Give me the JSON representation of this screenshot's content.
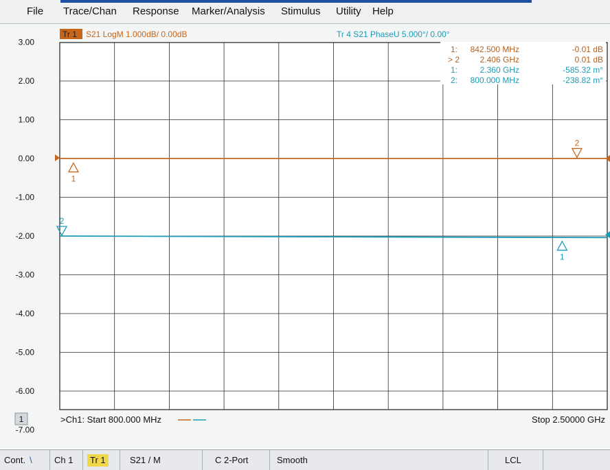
{
  "menu": {
    "items": [
      "File",
      "Trace/Chan",
      "Response",
      "Marker/Analysis",
      "Stimulus",
      "Utility",
      "Help"
    ]
  },
  "trace1": {
    "tag": "Tr 1",
    "label": "S21 LogM 1.000dB/ 0.00dB",
    "color": "#c7651a"
  },
  "trace4": {
    "label": "Tr 4  S21 PhaseU 5.000°/ 0.00°",
    "color": "#1b9bb7"
  },
  "marker_table": [
    {
      "id": "1:",
      "freq": "842.500 MHz",
      "value": "-0.01 dB",
      "trace": "tr1"
    },
    {
      "id": "> 2",
      "freq": "2.406 GHz",
      "value": "0.01 dB",
      "trace": "tr1"
    },
    {
      "id": "1:",
      "freq": "2.360 GHz",
      "value": "-585.32 m°",
      "trace": "tr4"
    },
    {
      "id": "2:",
      "freq": "800.000 MHz",
      "value": "-238.82 m°",
      "trace": "tr4"
    }
  ],
  "axis": {
    "y_ticks": [
      "3.00",
      "2.00",
      "1.00",
      "0.00",
      "-1.00",
      "-2.00",
      "-3.00",
      "-4.00",
      "-5.00",
      "-6.00",
      "-7.00"
    ],
    "start_label": ">Ch1: Start  800.000 MHz",
    "stop_label": "Stop  2.50000 GHz",
    "channel_box": "1"
  },
  "chart_data": {
    "type": "line",
    "x_unit": "MHz",
    "xlim": [
      800,
      2500
    ],
    "ylim": [
      -7,
      3
    ],
    "y_ticks": [
      3,
      2,
      1,
      0,
      -1,
      -2,
      -3,
      -4,
      -5,
      -6,
      -7
    ],
    "grid": true,
    "series": [
      {
        "name": "S21 LogM 1.000dB/ 0.00dB",
        "color": "#c7651a",
        "x": [
          800,
          2500
        ],
        "values": [
          0.0,
          0.0
        ]
      },
      {
        "name": "S21 PhaseU 5.000°/ 0.00°",
        "color": "#1b9bb7",
        "x": [
          800,
          2500
        ],
        "values": [
          -2.0,
          -2.04
        ]
      }
    ],
    "markers": [
      {
        "series": 0,
        "label": "1",
        "x": 842.5,
        "y": -0.01
      },
      {
        "series": 0,
        "label": "2",
        "x": 2406,
        "y": 0.01
      },
      {
        "series": 1,
        "label": "1",
        "x": 2360,
        "y": -2.03
      },
      {
        "series": 1,
        "label": "2",
        "x": 800,
        "y": -2.0
      }
    ]
  },
  "status_bar": {
    "cont": "Cont.",
    "ch": "Ch 1",
    "tr": "Tr 1",
    "param": "S21 / M",
    "cal": "C  2-Port",
    "smooth": "Smooth",
    "lcl": "LCL"
  }
}
